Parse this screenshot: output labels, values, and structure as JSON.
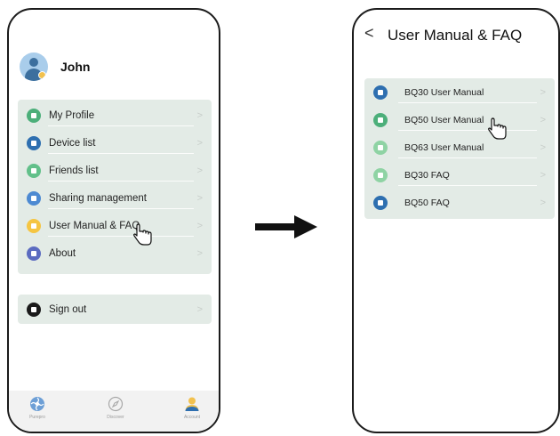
{
  "left_screen": {
    "user_name": "John",
    "menu": [
      {
        "label": "My Profile",
        "icon": "profile-card-icon",
        "color": "#4caf7a"
      },
      {
        "label": "Device list",
        "icon": "wrench-icon",
        "color": "#2e6fb0"
      },
      {
        "label": "Friends list",
        "icon": "friends-icon",
        "color": "#62c08a"
      },
      {
        "label": "Sharing management",
        "icon": "share-icon",
        "color": "#4d8ad2"
      },
      {
        "label": "User Manual & FAQ",
        "icon": "chat-bubble-icon",
        "color": "#f5c542"
      },
      {
        "label": "About",
        "icon": "info-person-icon",
        "color": "#5b6bc0"
      }
    ],
    "sign_out": {
      "label": "Sign out",
      "icon": "exit-icon",
      "color": "#1a1a1a"
    },
    "tabs": [
      {
        "label": "Purepro",
        "icon": "fan-icon"
      },
      {
        "label": "Discover",
        "icon": "compass-icon"
      },
      {
        "label": "Account",
        "icon": "account-icon"
      }
    ]
  },
  "right_screen": {
    "back_glyph": "<",
    "title": "User Manual & FAQ",
    "items": [
      {
        "label": "BQ30 User Manual",
        "icon": "manual-icon",
        "color": "#2e6fb0"
      },
      {
        "label": "BQ50 User Manual",
        "icon": "manual-icon",
        "color": "#4caf7a"
      },
      {
        "label": "BQ63 User Manual",
        "icon": "manual-icon",
        "color": "#8fd3a4"
      },
      {
        "label": "BQ30 FAQ",
        "icon": "faq-icon",
        "color": "#8fd3a4"
      },
      {
        "label": "BQ50 FAQ",
        "icon": "faq-icon",
        "color": "#2e6fb0"
      }
    ]
  },
  "chevron_glyph": ">"
}
